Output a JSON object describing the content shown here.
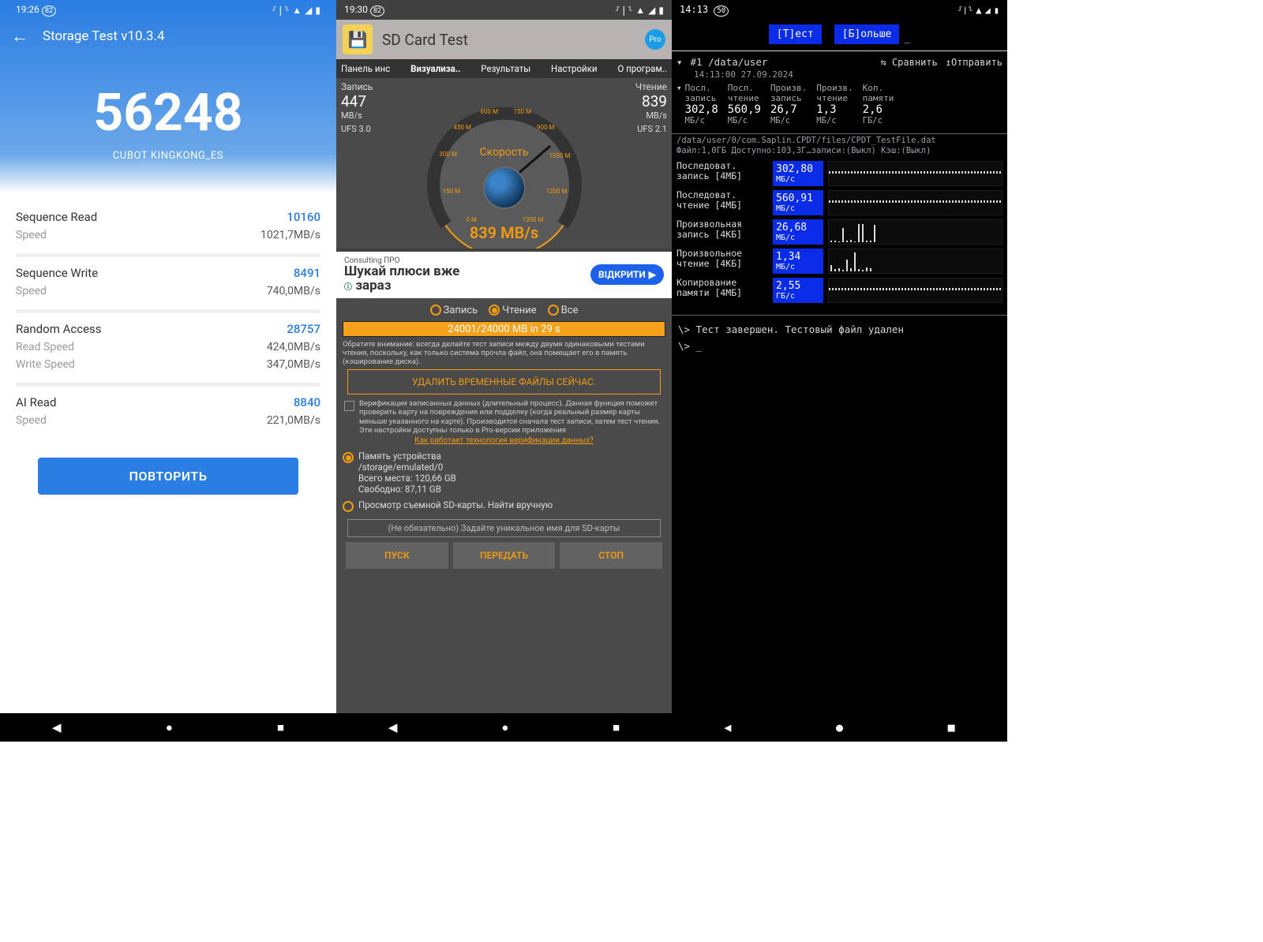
{
  "p1": {
    "status": {
      "time": "19:26",
      "batt": "82"
    },
    "title": "Storage Test v10.3.4",
    "score": "56248",
    "device": "CUBOT KINGKONG_ES",
    "sections": [
      {
        "head_label": "Sequence Read",
        "head_val": "10160",
        "rows": [
          {
            "label": "Speed",
            "val": "1021,7MB/s"
          }
        ]
      },
      {
        "head_label": "Sequence Write",
        "head_val": "8491",
        "rows": [
          {
            "label": "Speed",
            "val": "740,0MB/s"
          }
        ]
      },
      {
        "head_label": "Random Access",
        "head_val": "28757",
        "rows": [
          {
            "label": "Read Speed",
            "val": "424,0MB/s"
          },
          {
            "label": "Write Speed",
            "val": "347,0MB/s"
          }
        ]
      },
      {
        "head_label": "AI Read",
        "head_val": "8840",
        "rows": [
          {
            "label": "Speed",
            "val": "221,0MB/s"
          }
        ]
      }
    ],
    "repeat": "ПОВТОРИТЬ"
  },
  "p2": {
    "status": {
      "time": "19:30",
      "batt": "82"
    },
    "title": "SD Card Test",
    "pro": "Pro",
    "tabs": [
      {
        "t": "Панель инс",
        "active": false
      },
      {
        "t": "Визуализа..",
        "active": true
      },
      {
        "t": "Результаты",
        "active": false
      },
      {
        "t": "Настройки",
        "active": false
      },
      {
        "t": "О програм..",
        "active": false
      }
    ],
    "write": {
      "label": "Запись",
      "val": "447",
      "unit": "MB/s",
      "ufs": "UFS 3.0"
    },
    "read": {
      "label": "Чтение",
      "val": "839",
      "unit": "MB/s",
      "ufs": "UFS 2.1"
    },
    "gauge": {
      "label": "Скорость",
      "value": "839 MB/s",
      "ticks": [
        "0 M",
        "150 M",
        "300 M",
        "450 M",
        "600 M",
        "750 M",
        "900 M",
        "1050 M",
        "1200 M",
        "1350 M"
      ]
    },
    "ad": {
      "small": "Consulting ПРО",
      "big1": "Шукай плюси вже",
      "big2": "зараз",
      "open": "ВІДКРИТИ"
    },
    "radios": {
      "write": "Запись",
      "read": "Чтение",
      "all": "Все"
    },
    "progress": "24001/24000 MB in 29 s",
    "note": "Обратите внимание: всегда делайте тест записи между двумя одинаковыми тестами чтения, поскольку, как только система прочла файл, она помещает его в память (кэширование диска).",
    "delete": "УДАЛИТЬ ВРЕМЕННЫЕ ФАЙЛЫ СЕЙЧАС.",
    "verify": "Верификация записанных данных (длительный процесс). Данная функция поможет проверить карту на повреждения или подделку (когда реальный размер карты меньше указанного на карте). Производится сначала тест записи, затем тест чтения. Эти настройки доступны только в Pro-версии приложения",
    "verify_link": "Как работает технология верификации данных?",
    "storage": {
      "internal_title": "Память устройства",
      "internal_path": "/storage/emulated/0",
      "internal_total": "Всего места: 120,66 GB",
      "internal_free": "Свободно: 87,11 GB",
      "external_title": "Просмотр съемной SD-карты. Найти вручную"
    },
    "name_hint": "(Не обязательно) Задайте уникальное имя для SD-карты",
    "actions": {
      "start": "ПУСК",
      "send": "ПЕРЕДАТЬ",
      "stop": "СТОП"
    }
  },
  "p3": {
    "status": {
      "time": "14:13",
      "batt": "50"
    },
    "tabs": {
      "test": "[Т]ест",
      "more": "[Б]ольше"
    },
    "run": {
      "id": "#1 /data/user",
      "compare": "⇆ Сравнить",
      "send": "↥Отправить",
      "time": "14:13:00 27.09.2024"
    },
    "summary": [
      {
        "lab1": "Посл.",
        "lab2": "запись",
        "v": "302,8",
        "u": "МБ/с"
      },
      {
        "lab1": "Посл.",
        "lab2": "чтение",
        "v": "560,9",
        "u": "МБ/с"
      },
      {
        "lab1": "Произв.",
        "lab2": "запись",
        "v": "26,7",
        "u": "МБ/с"
      },
      {
        "lab1": "Произв.",
        "lab2": "чтение",
        "v": "1,3",
        "u": "МБ/с"
      },
      {
        "lab1": "Коп.",
        "lab2": "памяти",
        "v": "2,6",
        "u": "ГБ/с"
      }
    ],
    "path1": "/data/user/0/com.Saplin.CPDT/files/CPDT_TestFile.dat",
    "path2": "Файл:1,0ГБ Доступно:103,3Г…записи:(Выкл) Кэш:(Выкл)",
    "tests": [
      {
        "name1": "Последоват.",
        "name2": "запись [4МБ]",
        "v": "302,80",
        "u": "МБ/с",
        "style": "wavy"
      },
      {
        "name1": "Последоват.",
        "name2": "чтение [4МБ]",
        "v": "560,91",
        "u": "МБ/с",
        "style": "wavy"
      },
      {
        "name1": "Произвольная",
        "name2": "запись [4КБ]",
        "v": "26,68",
        "u": "МБ/с",
        "style": "bars"
      },
      {
        "name1": "Произвольное",
        "name2": "чтение [4КБ]",
        "v": "1,34",
        "u": "МБ/с",
        "style": "bars"
      },
      {
        "name1": "Копирование",
        "name2": "памяти [4МБ]",
        "v": "2,55",
        "u": "ГБ/с",
        "style": "wavy"
      }
    ],
    "term": {
      "l1": "\\> Тест завершен. Тестовый файл удален",
      "l2": "\\> _"
    }
  }
}
